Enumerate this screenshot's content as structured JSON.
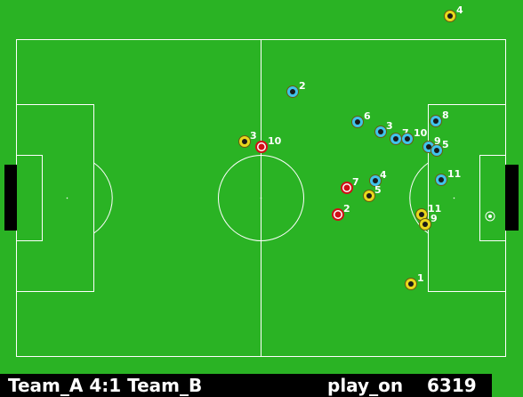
{
  "scoreboard": {
    "score_text": "Team_A 4:1 Team_B",
    "play_mode": "play_on",
    "cycle": "6319"
  },
  "colors": {
    "field": "#2ab324",
    "lines": "#ffffff",
    "team_a": "#e8d81c",
    "team_b": "#3fc4ec",
    "ball": "#ffffff",
    "highlight": "#d10f17",
    "goal": "#000000"
  },
  "players": [
    {
      "team": "yellow",
      "number": "4"
    },
    {
      "team": "blue",
      "number": "2"
    },
    {
      "team": "blue",
      "number": "6"
    },
    {
      "team": "blue",
      "number": "3"
    },
    {
      "team": "blue",
      "number": "7"
    },
    {
      "team": "blue",
      "number": "10"
    },
    {
      "team": "blue",
      "number": "8"
    },
    {
      "team": "blue",
      "number": "9"
    },
    {
      "team": "blue",
      "number": "5"
    },
    {
      "team": "blue",
      "number": "11"
    },
    {
      "team": "blue",
      "number": "4"
    },
    {
      "team": "yellow",
      "number": "3"
    },
    {
      "team": "red",
      "number": "10"
    },
    {
      "team": "red",
      "number": "7"
    },
    {
      "team": "red",
      "number": "2"
    },
    {
      "team": "yellow",
      "number": "5"
    },
    {
      "team": "yellow",
      "number": "11"
    },
    {
      "team": "yellow",
      "number": "9"
    },
    {
      "team": "yellow",
      "number": "1"
    }
  ]
}
